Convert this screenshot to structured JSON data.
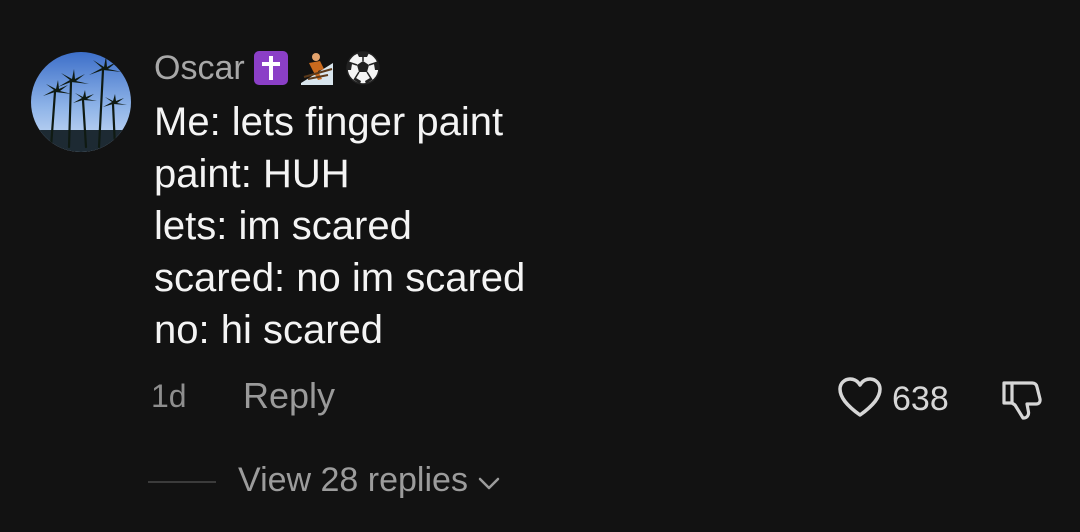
{
  "comment": {
    "author": "Oscar",
    "author_emojis": [
      "latin-cross-emoji",
      "skier-emoji",
      "soccer-ball-emoji"
    ],
    "lines": [
      "Me: lets finger paint",
      "paint: HUH",
      "lets: im scared",
      "scared: no im scared",
      "no: hi scared"
    ],
    "timestamp": "1d",
    "reply_label": "Reply",
    "like_count": "638",
    "view_replies_label": "View 28 replies"
  },
  "colors": {
    "background": "#121212",
    "text_primary": "#f4f4f4",
    "text_secondary": "#9c9c9c",
    "cross_badge": "#8b3fc7"
  }
}
